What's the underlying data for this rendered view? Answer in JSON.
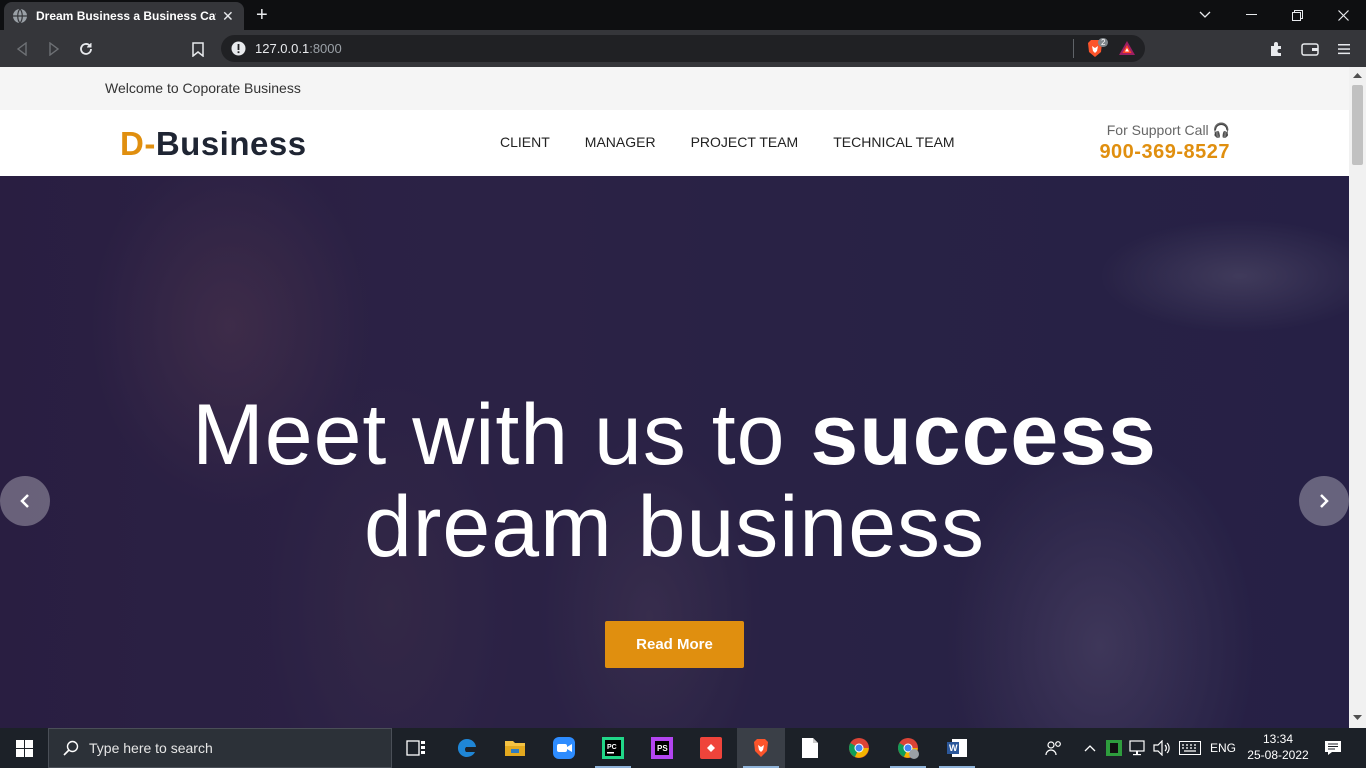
{
  "browser": {
    "tab_title": "Dream Business a Business Category",
    "url_host": "127.0.0.1",
    "url_port": ":8000",
    "brave_badge": "2"
  },
  "site": {
    "welcome_text": "Welcome to Coporate Business",
    "logo_prefix": "D-",
    "logo_name": "Business",
    "nav": [
      {
        "label": "CLIENT"
      },
      {
        "label": "MANAGER"
      },
      {
        "label": "PROJECT TEAM"
      },
      {
        "label": "TECHNICAL TEAM"
      }
    ],
    "support_label": "For Support Call",
    "support_phone": "900-369-8527",
    "hero": {
      "line1_light": "Meet with us to ",
      "line1_bold": "success",
      "line2": "dream business",
      "cta_label": "Read More"
    },
    "colors": {
      "accent": "#e08f0f",
      "dark": "#1f2533"
    }
  },
  "taskbar": {
    "search_placeholder": "Type here to search",
    "language": "ENG",
    "time": "13:34",
    "date": "25-08-2022",
    "apps": [
      {
        "name": "task-view-icon"
      },
      {
        "name": "edge-icon"
      },
      {
        "name": "file-explorer-icon"
      },
      {
        "name": "zoom-icon"
      },
      {
        "name": "pycharm-icon"
      },
      {
        "name": "phpstorm-icon"
      },
      {
        "name": "anydesk-icon"
      },
      {
        "name": "brave-icon"
      },
      {
        "name": "notepad-icon"
      },
      {
        "name": "chrome-icon"
      },
      {
        "name": "chrome-profile-icon"
      },
      {
        "name": "word-icon"
      }
    ]
  }
}
